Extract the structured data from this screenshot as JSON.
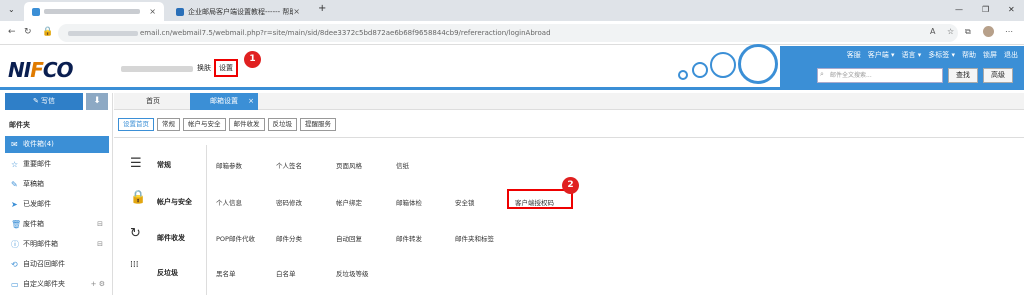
{
  "browser": {
    "tab2_title": "企业邮局客户端设置教程------ 帮助",
    "new_tab": "+",
    "url_suffix": "email.cn/webmail7.5/webmail.php?r=site/main/sid/8dee3372c5bd872ae6b68f9658844cb9/refereraction/loginAbroad"
  },
  "header": {
    "logo_a": "NI",
    "logo_f": "F",
    "logo_b": "CO",
    "switch_label": "换肤",
    "settings_label": "设置",
    "badge1": "1",
    "top_links": [
      "客服",
      "客户端 ▾",
      "语言 ▾",
      "多标签 ▾",
      "帮助",
      "锁屏",
      "退出"
    ],
    "search_placeholder": "邮件全文搜索...",
    "search_btn": "查找",
    "advanced_btn": "高级"
  },
  "sidebar": {
    "write_label": "写信",
    "folders_title": "邮件夹",
    "items": [
      {
        "icon": "✉",
        "label": "收件箱(4)"
      },
      {
        "icon": "☆",
        "label": "重要邮件"
      },
      {
        "icon": "✎",
        "label": "草稿箱"
      },
      {
        "icon": "➤",
        "label": "已发邮件"
      },
      {
        "icon": "🗑",
        "label": "废件箱"
      },
      {
        "icon": "ⓘ",
        "label": "不明邮件箱"
      },
      {
        "icon": "⟲",
        "label": "自动召回邮件"
      },
      {
        "icon": "▭",
        "label": "自定义邮件夹"
      }
    ],
    "trash_clear": "⊟",
    "unknown_clear": "⊟",
    "custom_actions": "+ ⚙"
  },
  "main": {
    "tabs": [
      "首页",
      "邮箱设置"
    ],
    "tab_close": "×",
    "subtabs": [
      "设置首页",
      "常规",
      "帐户与安全",
      "邮件收发",
      "反垃圾",
      "提醒服务"
    ],
    "sections": [
      {
        "icon": "☰",
        "title": "常规",
        "items": [
          "邮箱参数",
          "个人签名",
          "页面风格",
          "信纸"
        ]
      },
      {
        "icon": "🔒",
        "title": "帐户与安全",
        "items": [
          "个人信息",
          "密码修改",
          "帐户绑定",
          "邮箱体检",
          "安全锁",
          "客户端授权码"
        ]
      },
      {
        "icon": "↻",
        "title": "邮件收发",
        "items": [
          "POP邮件代收",
          "邮件分类",
          "自动回复",
          "邮件转发",
          "邮件夹和标签"
        ]
      },
      {
        "icon": "⁞⁞⁞",
        "title": "反垃圾",
        "items": [
          "黑名单",
          "白名单",
          "反垃圾等级"
        ]
      }
    ],
    "badge2": "2"
  },
  "colors": {
    "accent": "#3b8fd6",
    "highlight": "#e00000"
  }
}
